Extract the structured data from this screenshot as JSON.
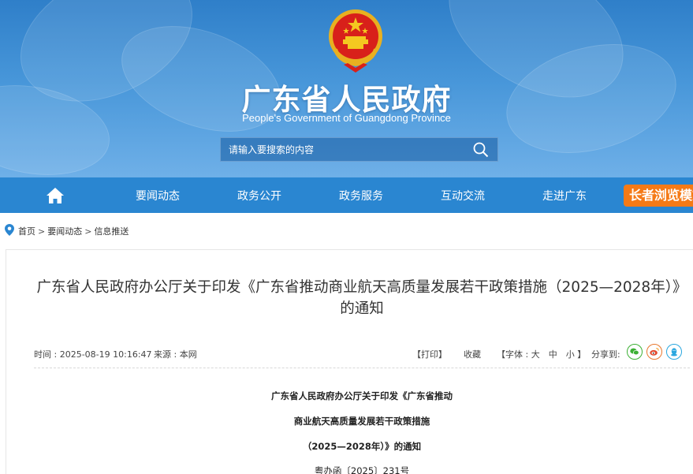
{
  "header": {
    "title": "广东省人民政府",
    "subtitle": "People's Government of Guangdong Province",
    "emblem_icon": "national-emblem-icon"
  },
  "search": {
    "placeholder": "请输入要搜索的内容",
    "icon": "search-icon"
  },
  "nav": {
    "home_icon": "home-icon",
    "items": [
      {
        "label": "要闻动态"
      },
      {
        "label": "政务公开"
      },
      {
        "label": "政务服务"
      },
      {
        "label": "互动交流"
      },
      {
        "label": "走进广东"
      }
    ],
    "elder_mode_label": "长者浏览模式"
  },
  "breadcrumb": {
    "icon": "location-pin-icon",
    "items": [
      "首页",
      "要闻动态",
      "信息推送"
    ],
    "separator": ">"
  },
  "article": {
    "title": "广东省人民政府办公厅关于印发《广东省推动商业航天高质量发展若干政策措施（2025—2028年）》的通知",
    "time_label": "时间 : 2025-08-19 10:16:47",
    "source_label": "来源 : 本网",
    "print_label": "【打印】",
    "favorite_label": "收藏",
    "font_size_label": "【字体 : 大　中　小 】",
    "share_label": "分享到:",
    "share_icons": [
      "wechat-icon",
      "weibo-icon",
      "qq-icon"
    ],
    "body_lines": [
      "广东省人民政府办公厅关于印发《广东省推动",
      "商业航天高质量发展若干政策措施",
      "（2025—2028年）》的通知",
      "粤办函〔2025〕231号"
    ]
  },
  "colors": {
    "header_blue": "#3c8ed6",
    "nav_blue": "#2a86d1",
    "elder_orange": "#f57a16",
    "wechat_green": "#3cb034",
    "weibo_orange": "#e8772e",
    "qq_blue": "#2aa7df"
  }
}
